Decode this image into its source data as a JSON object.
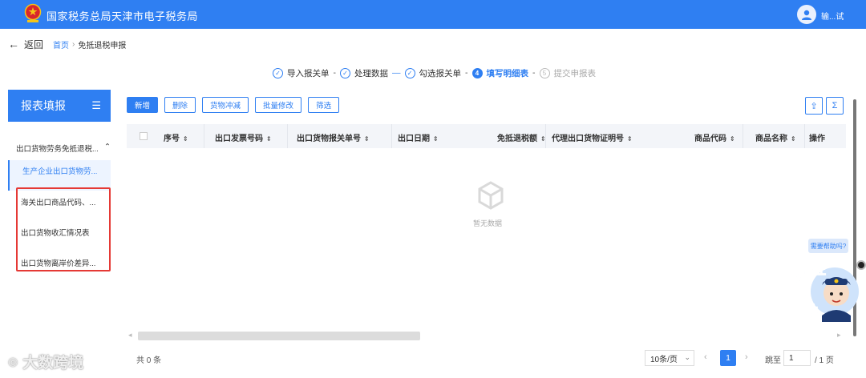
{
  "header": {
    "title": "国家税务总局天津市电子税务局",
    "user": "输...试"
  },
  "nav": {
    "back": "返回",
    "crumb_home": "首页",
    "crumb_sep": "›",
    "crumb_current": "免抵退税申报"
  },
  "steps": [
    {
      "icon": "✓",
      "label": "导入报关单",
      "state": "done"
    },
    {
      "icon": "✓",
      "label": "处理数据",
      "state": "done"
    },
    {
      "icon": "✓",
      "label": "勾选报关单",
      "state": "done"
    },
    {
      "icon": "4",
      "label": "填写明细表",
      "state": "active"
    },
    {
      "icon": "5",
      "label": "提交申报表",
      "state": "pending"
    }
  ],
  "step_connectors": [
    "-",
    "—",
    "-",
    "-"
  ],
  "sidebar": {
    "title": "报表填报",
    "menu_icon": "☰",
    "group": "出口货物劳务免抵退税...",
    "group_caret": "⌃",
    "items": [
      {
        "label": "生产企业出口货物劳..."
      },
      {
        "label": "海关出口商品代码、..."
      },
      {
        "label": "出口货物收汇情况表"
      },
      {
        "label": "出口货物离岸价差异..."
      }
    ]
  },
  "toolbar": {
    "buttons": [
      "新增",
      "删除",
      "货物冲减",
      "批量修改",
      "筛选"
    ],
    "export_icon": "⇪",
    "sum_icon": "Σ"
  },
  "table": {
    "sort_glyph": "⇕",
    "columns": [
      "序号",
      "出口发票号码",
      "出口货物报关单号",
      "出口日期",
      "免抵退税额",
      "代理出口货物证明号",
      "商品代码",
      "商品名称",
      "操作"
    ],
    "empty_text": "暂无数据"
  },
  "pagination": {
    "total": "共 0 条",
    "page_size": "10条/页",
    "page_size_caret": "⌄",
    "prev": "‹",
    "current_page": "1",
    "next": "›",
    "goto_label": "跳至",
    "goto_value": "1",
    "total_pages": "/ 1 页"
  },
  "help": {
    "bubble": "需要帮助吗?"
  },
  "watermark": {
    "text": "大数跨境"
  },
  "colors": {
    "primary": "#2f7ff2",
    "highlight_box": "#e53935"
  }
}
